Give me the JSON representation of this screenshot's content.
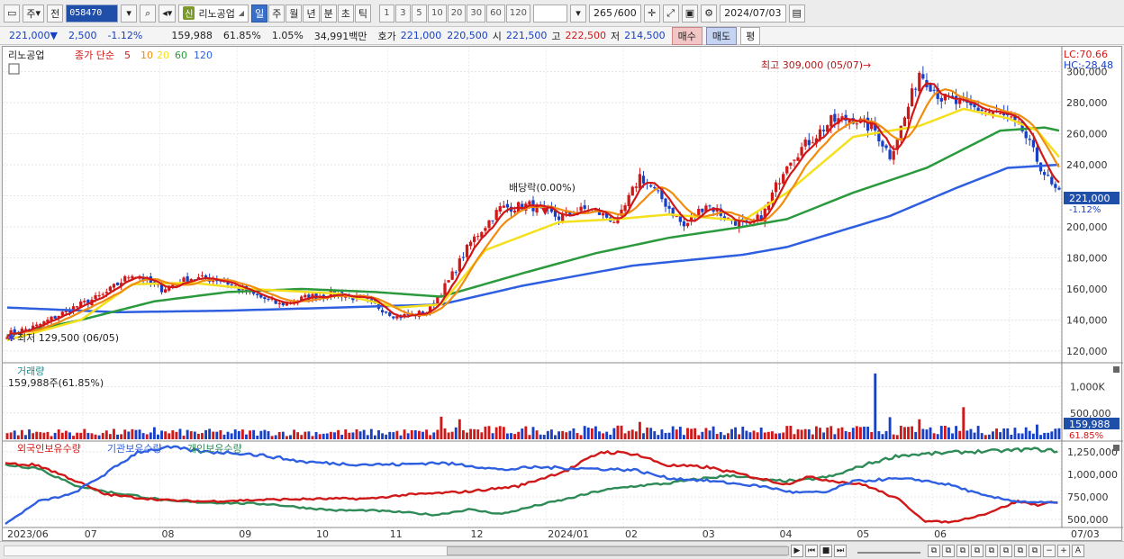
{
  "toolbar": {
    "period_type": "주",
    "prev_label": "전",
    "stock_code": "058470",
    "stock_badge": "신",
    "stock_name": "리노공업",
    "period_buttons": [
      "일",
      "주",
      "월",
      "년",
      "분",
      "초",
      "틱"
    ],
    "active_period": "일",
    "interval_buttons": [
      "1",
      "3",
      "5",
      "10",
      "20",
      "30",
      "60",
      "120"
    ],
    "range_value": "265",
    "range_total": "/600",
    "date_value": "2024/07/03"
  },
  "infobar": {
    "price": "221,000▼",
    "change": "2,500",
    "change_pct": "-1.12%",
    "volume": "159,988",
    "vol_ratio": "61.85%",
    "turnover": "1.05%",
    "amount": "34,991백만",
    "quote_label": "호가",
    "bid": "221,000",
    "ask": "220,500",
    "open_label": "시",
    "open": "221,500",
    "high_label": "고",
    "high": "222,500",
    "low_label": "저",
    "low": "214,500",
    "buy_label": "매수",
    "sell_label": "매도",
    "even_label": "평"
  },
  "colors": {
    "up": "#d01818",
    "down": "#1740c4",
    "ma5": "#d01818",
    "ma10": "#f08c10",
    "ma20": "#f4e01c",
    "ma60": "#2a9a3c",
    "ma120": "#2e5fe0",
    "foreign": "#d01818",
    "institution": "#2e5fe0",
    "individual": "#2e8a56"
  },
  "chart_data": [
    {
      "type": "candlestick",
      "legend_name": "리노공업",
      "legend_series": "종가 단순",
      "ma_periods": [
        "5",
        "10",
        "20",
        "60",
        "120"
      ],
      "lc_label": "LC:70.66",
      "hc_label": "HC:-28.48",
      "max_annotation": "최고 309,000 (05/07)",
      "min_annotation": "최저 129,500 (06/05)",
      "event_annotation": "배당락(0.00%)",
      "current_price_label": "221,000",
      "current_change_label": "-1.12%",
      "ylim": [
        113000,
        316000
      ],
      "y_ticks": [
        "120,000",
        "140,000",
        "160,000",
        "180,000",
        "200,000",
        "220,000",
        "240,000",
        "260,000",
        "280,000",
        "300,000"
      ],
      "x_ticks": [
        "2023/06",
        "07",
        "08",
        "09",
        "10",
        "11",
        "12",
        "2024/01",
        "02",
        "03",
        "04",
        "05",
        "06",
        "07/03"
      ],
      "anchors_close": [
        [
          0,
          131000
        ],
        [
          8,
          136000
        ],
        [
          18,
          148000
        ],
        [
          26,
          156000
        ],
        [
          34,
          170000
        ],
        [
          42,
          160000
        ],
        [
          50,
          167000
        ],
        [
          58,
          166000
        ],
        [
          66,
          157000
        ],
        [
          74,
          150000
        ],
        [
          82,
          155000
        ],
        [
          90,
          157000
        ],
        [
          98,
          152000
        ],
        [
          106,
          142000
        ],
        [
          114,
          145000
        ],
        [
          120,
          165000
        ],
        [
          126,
          190000
        ],
        [
          134,
          212000
        ],
        [
          142,
          214000
        ],
        [
          150,
          206000
        ],
        [
          158,
          212000
        ],
        [
          166,
          203000
        ],
        [
          172,
          233000
        ],
        [
          178,
          218000
        ],
        [
          184,
          200000
        ],
        [
          190,
          215000
        ],
        [
          196,
          205000
        ],
        [
          202,
          200000
        ],
        [
          206,
          210000
        ],
        [
          212,
          242000
        ],
        [
          218,
          255000
        ],
        [
          224,
          268000
        ],
        [
          230,
          270000
        ],
        [
          236,
          262000
        ],
        [
          240,
          246000
        ],
        [
          244,
          270000
        ],
        [
          248,
          300000
        ],
        [
          254,
          283000
        ],
        [
          260,
          278000
        ],
        [
          266,
          275000
        ],
        [
          272,
          270000
        ],
        [
          276,
          262000
        ],
        [
          280,
          243000
        ],
        [
          284,
          226000
        ],
        [
          286,
          221000
        ]
      ],
      "ma20_anchors": [
        [
          0,
          127000
        ],
        [
          20,
          140000
        ],
        [
          34,
          163000
        ],
        [
          50,
          164000
        ],
        [
          66,
          160000
        ],
        [
          90,
          157000
        ],
        [
          106,
          148000
        ],
        [
          118,
          150000
        ],
        [
          130,
          185000
        ],
        [
          150,
          203000
        ],
        [
          166,
          205000
        ],
        [
          180,
          208000
        ],
        [
          200,
          204000
        ],
        [
          212,
          222000
        ],
        [
          230,
          258000
        ],
        [
          248,
          265000
        ],
        [
          260,
          276000
        ],
        [
          272,
          270000
        ],
        [
          280,
          262000
        ],
        [
          286,
          245000
        ]
      ],
      "ma60_anchors": [
        [
          0,
          130000
        ],
        [
          20,
          140000
        ],
        [
          40,
          152000
        ],
        [
          60,
          158000
        ],
        [
          80,
          160000
        ],
        [
          100,
          158000
        ],
        [
          118,
          155000
        ],
        [
          140,
          170000
        ],
        [
          160,
          183000
        ],
        [
          180,
          193000
        ],
        [
          200,
          200000
        ],
        [
          212,
          205000
        ],
        [
          230,
          222000
        ],
        [
          250,
          238000
        ],
        [
          270,
          262000
        ],
        [
          282,
          264000
        ],
        [
          286,
          262000
        ]
      ],
      "ma120_anchors": [
        [
          0,
          148000
        ],
        [
          30,
          145000
        ],
        [
          60,
          146000
        ],
        [
          90,
          148000
        ],
        [
          118,
          150000
        ],
        [
          140,
          162000
        ],
        [
          170,
          175000
        ],
        [
          200,
          182000
        ],
        [
          212,
          187000
        ],
        [
          240,
          207000
        ],
        [
          258,
          225000
        ],
        [
          272,
          238000
        ],
        [
          286,
          240000
        ]
      ]
    },
    {
      "type": "bar",
      "legend_name": "거래량",
      "value_label": "159,988주(61.85%)",
      "current_label": "159,988",
      "current_pct": "61.85%",
      "ylim": [
        0,
        1300000
      ],
      "y_ticks": [
        "500,000",
        "1,000K"
      ],
      "spikes": [
        [
          40,
          230000
        ],
        [
          118,
          430000
        ],
        [
          123,
          380000
        ],
        [
          172,
          330000
        ],
        [
          236,
          1250000
        ],
        [
          240,
          420000
        ],
        [
          248,
          380000
        ],
        [
          260,
          610000
        ],
        [
          280,
          280000
        ]
      ]
    },
    {
      "type": "line",
      "legend_series": [
        "외국인보유수량",
        "기관보유수량",
        "개인보유수량"
      ],
      "ylim": [
        430000,
        1350000
      ],
      "y_ticks": [
        "500,000",
        "750,000",
        "1,000,000",
        "1,250,000"
      ],
      "foreign": [
        [
          0,
          1120000
        ],
        [
          10,
          1100000
        ],
        [
          20,
          950000
        ],
        [
          30,
          780000
        ],
        [
          40,
          740000
        ],
        [
          50,
          710000
        ],
        [
          60,
          700000
        ],
        [
          70,
          710000
        ],
        [
          80,
          720000
        ],
        [
          100,
          730000
        ],
        [
          110,
          730000
        ],
        [
          120,
          770000
        ],
        [
          140,
          810000
        ],
        [
          155,
          870000
        ],
        [
          170,
          1050000
        ],
        [
          180,
          1250000
        ],
        [
          190,
          1230000
        ],
        [
          200,
          1100000
        ],
        [
          212,
          1080000
        ],
        [
          220,
          1020000
        ],
        [
          236,
          890000
        ],
        [
          242,
          970000
        ],
        [
          250,
          930000
        ],
        [
          260,
          880000
        ],
        [
          270,
          720000
        ],
        [
          278,
          480000
        ],
        [
          286,
          470000
        ],
        [
          296,
          560000
        ],
        [
          306,
          700000
        ],
        [
          312,
          660000
        ],
        [
          318,
          700000
        ]
      ],
      "institution": [
        [
          0,
          450000
        ],
        [
          10,
          700000
        ],
        [
          20,
          780000
        ],
        [
          30,
          1000000
        ],
        [
          40,
          1250000
        ],
        [
          50,
          1300000
        ],
        [
          60,
          1250000
        ],
        [
          70,
          1240000
        ],
        [
          80,
          1200000
        ],
        [
          90,
          1140000
        ],
        [
          100,
          1120000
        ],
        [
          110,
          1110000
        ],
        [
          120,
          1110000
        ],
        [
          130,
          1130000
        ],
        [
          140,
          1100000
        ],
        [
          150,
          1050000
        ],
        [
          160,
          1080000
        ],
        [
          170,
          1070000
        ],
        [
          180,
          1060000
        ],
        [
          190,
          1050000
        ],
        [
          200,
          960000
        ],
        [
          212,
          930000
        ],
        [
          220,
          900000
        ],
        [
          230,
          860000
        ],
        [
          238,
          800000
        ],
        [
          248,
          800000
        ],
        [
          256,
          920000
        ],
        [
          268,
          950000
        ],
        [
          276,
          940000
        ],
        [
          286,
          880000
        ],
        [
          296,
          760000
        ],
        [
          306,
          700000
        ],
        [
          312,
          690000
        ],
        [
          318,
          680000
        ]
      ],
      "individual": [
        [
          0,
          1110000
        ],
        [
          10,
          1070000
        ],
        [
          20,
          890000
        ],
        [
          30,
          810000
        ],
        [
          40,
          760000
        ],
        [
          50,
          700000
        ],
        [
          60,
          690000
        ],
        [
          70,
          680000
        ],
        [
          80,
          670000
        ],
        [
          90,
          630000
        ],
        [
          100,
          600000
        ],
        [
          110,
          600000
        ],
        [
          120,
          580000
        ],
        [
          130,
          550000
        ],
        [
          140,
          610000
        ],
        [
          150,
          560000
        ],
        [
          160,
          650000
        ],
        [
          170,
          730000
        ],
        [
          180,
          820000
        ],
        [
          190,
          870000
        ],
        [
          200,
          900000
        ],
        [
          212,
          960000
        ],
        [
          220,
          990000
        ],
        [
          230,
          930000
        ],
        [
          240,
          930000
        ],
        [
          250,
          980000
        ],
        [
          260,
          1110000
        ],
        [
          270,
          1210000
        ],
        [
          280,
          1230000
        ],
        [
          290,
          1250000
        ],
        [
          300,
          1260000
        ],
        [
          310,
          1280000
        ],
        [
          318,
          1260000
        ]
      ]
    }
  ],
  "scroll_controls": [
    "▶",
    "⏮",
    "■",
    "⏭"
  ],
  "tool_icons": [
    "−",
    "+",
    "A"
  ]
}
